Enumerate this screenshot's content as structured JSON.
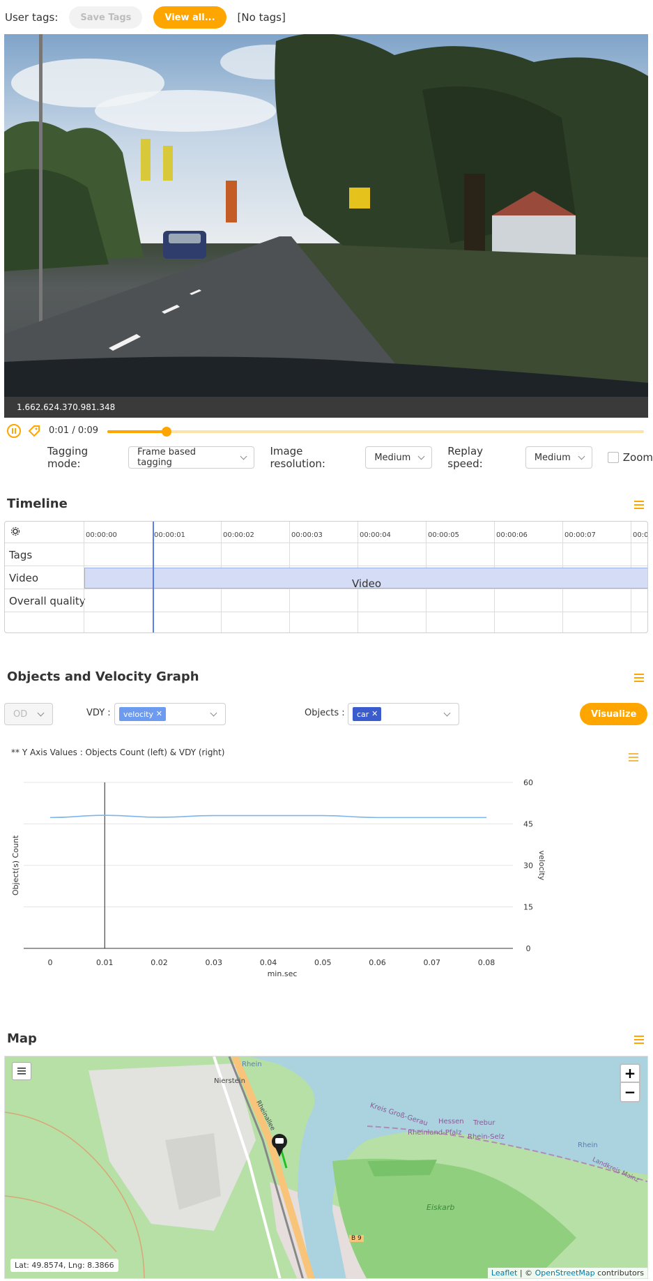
{
  "tags": {
    "label": "User tags:",
    "save_label": "Save Tags",
    "view_all_label": "View all...",
    "current": "[No tags]"
  },
  "video": {
    "timestamp": "1.662.624.370.981.348",
    "time_display": "0:01 / 0:09",
    "progress": 0.11
  },
  "settings": {
    "tagging_mode_label": "Tagging mode:",
    "tagging_mode_value": "Frame based tagging",
    "resolution_label": "Image resolution:",
    "resolution_value": "Medium",
    "replay_label": "Replay speed:",
    "replay_value": "Medium",
    "zoom_label": "Zoom"
  },
  "timeline": {
    "title": "Timeline",
    "ticks": [
      "00:00:00",
      "00:00:01",
      "00:00:02",
      "00:00:03",
      "00:00:04",
      "00:00:05",
      "00:00:06",
      "00:00:07",
      "00:00:0"
    ],
    "rows": [
      "Tags",
      "Video",
      "Overall quality"
    ],
    "video_bar_label": "Video"
  },
  "objects": {
    "title": "Objects and Velocity Graph",
    "od_value": "OD",
    "vdy_label": "VDY :",
    "vdy_chip": "velocity",
    "objects_label": "Objects :",
    "objects_chip": "car",
    "visualize_label": "Visualize"
  },
  "chart_data": {
    "type": "line",
    "title": "** Y Axis Values : Objects Count (left) & VDY (right)",
    "xlabel": "min.sec",
    "ylabel_left": "Object(s) Count",
    "ylabel_right": "velocity",
    "x_ticks": [
      "0",
      "0.01",
      "0.02",
      "0.03",
      "0.04",
      "0.05",
      "0.06",
      "0.07",
      "0.08"
    ],
    "y_right_ticks": [
      "60",
      "45",
      "30",
      "15",
      "0"
    ],
    "ylim_right": [
      0,
      60
    ],
    "xlim": [
      0,
      0.08
    ],
    "cursor_x": 0.01,
    "series": [
      {
        "name": "velocity",
        "color": "#7cb5ec",
        "x": [
          0,
          0.01,
          0.02,
          0.03,
          0.04,
          0.05,
          0.06,
          0.07,
          0.08
        ],
        "values": [
          47.3,
          48.1,
          47.4,
          48.0,
          48.0,
          48.0,
          47.3,
          47.3,
          47.3
        ]
      }
    ]
  },
  "map": {
    "title": "Map",
    "zoom_in": "+",
    "zoom_out": "−",
    "coords": "Lat: 49.8574, Lng: 8.3866",
    "attribution_leaflet": "Leaflet",
    "attribution_osm": "OpenStreetMap",
    "attribution_suffix": "contributors",
    "labels": {
      "rhein1": "Rhein",
      "rhein2": "Rhein",
      "kreis": "Kreis Groß-Gerau",
      "hessen": "Hessen",
      "trebur": "Trebur",
      "rlp": "Rheinland-Pfalz",
      "rheinselz": "Rhein-Selz",
      "eiskarb": "Eiskarb",
      "nierstein": "Nierstein",
      "rheinallee": "Rheinallee",
      "b9": "B 9",
      "landkreis": "Landkreis Mainz"
    }
  }
}
